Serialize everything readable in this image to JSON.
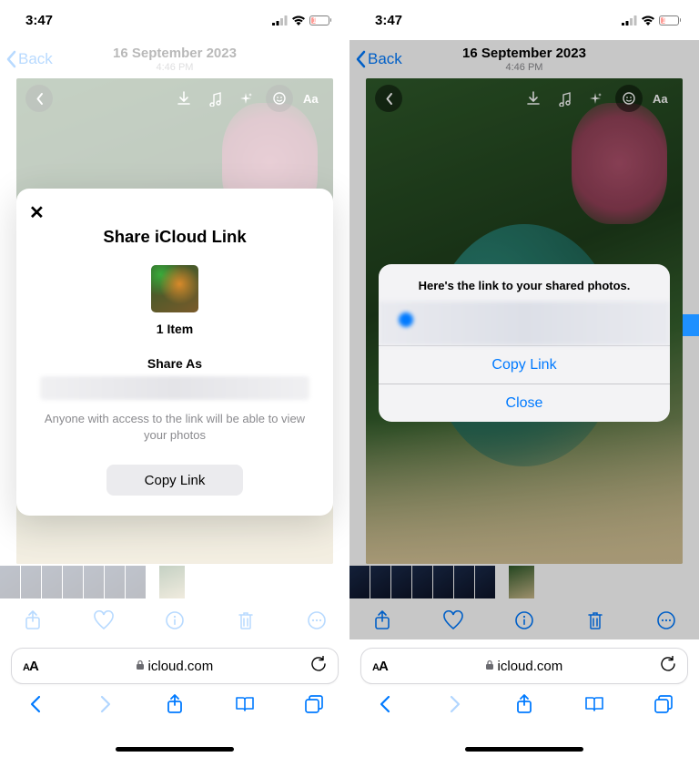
{
  "left": {
    "status": {
      "time": "3:47",
      "battery_pct": "15"
    },
    "nav": {
      "back": "Back",
      "title": "16 September 2023",
      "subtitle": "4:46 PM"
    },
    "share_sheet": {
      "title": "Share iCloud Link",
      "item_count": "1 Item",
      "share_as_label": "Share As",
      "description": "Anyone with access to the link will be able to view your photos",
      "copy_link": "Copy Link"
    },
    "url": "icloud.com"
  },
  "right": {
    "status": {
      "time": "3:47",
      "battery_pct": "14"
    },
    "nav": {
      "back": "Back",
      "title": "16 September 2023",
      "subtitle": "4:46 PM"
    },
    "alert": {
      "header": "Here's the link to your shared photos.",
      "copy": "Copy Link",
      "close": "Close"
    },
    "url": "icloud.com"
  },
  "safari": {
    "aa": "AA"
  }
}
